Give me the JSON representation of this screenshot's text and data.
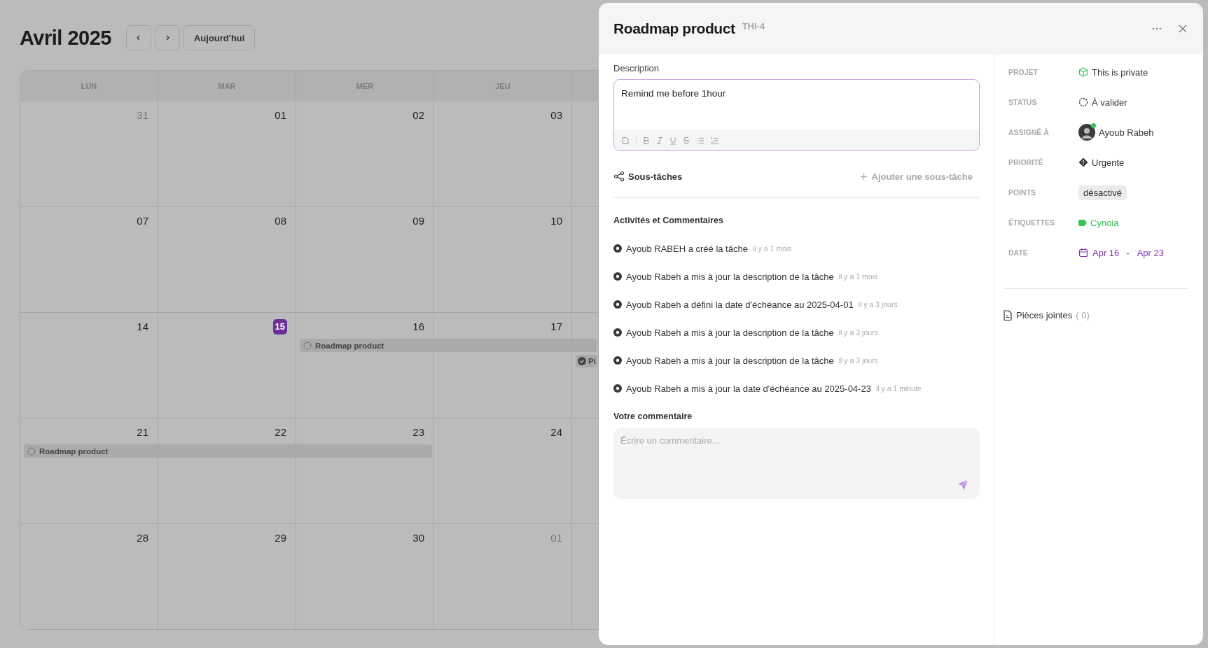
{
  "calendar": {
    "title": "Avril 2025",
    "today_button": "Aujourd'hui",
    "weekdays": [
      "LUN",
      "MAR",
      "MER",
      "JEU"
    ],
    "weeks": [
      {
        "days": [
          {
            "label": "31",
            "muted": true,
            "today": false
          },
          {
            "label": "01",
            "muted": false,
            "today": false
          },
          {
            "label": "02",
            "muted": false,
            "today": false
          },
          {
            "label": "03",
            "muted": false,
            "today": false
          }
        ]
      },
      {
        "days": [
          {
            "label": "07",
            "muted": false,
            "today": false
          },
          {
            "label": "08",
            "muted": false,
            "today": false
          },
          {
            "label": "09",
            "muted": false,
            "today": false
          },
          {
            "label": "10",
            "muted": false,
            "today": false
          }
        ]
      },
      {
        "days": [
          {
            "label": "14",
            "muted": false,
            "today": false
          },
          {
            "label": "15",
            "muted": false,
            "today": true
          },
          {
            "label": "16",
            "muted": false,
            "today": false,
            "bar": {
              "kind": "pending",
              "label": "Roadmap product"
            }
          },
          {
            "label": "17",
            "muted": false,
            "today": false,
            "bar_continues": true
          }
        ],
        "next_day": {
          "bar_continues": true,
          "chip": {
            "kind": "done",
            "label": "Pi"
          }
        }
      },
      {
        "days": [
          {
            "label": "21",
            "muted": false,
            "today": false,
            "bar": {
              "kind": "pending",
              "label": "Roadmap product"
            }
          },
          {
            "label": "22",
            "muted": false,
            "today": false,
            "bar_continues": true
          },
          {
            "label": "23",
            "muted": false,
            "today": false,
            "bar_continues": true
          },
          {
            "label": "24",
            "muted": false,
            "today": false
          }
        ]
      },
      {
        "days": [
          {
            "label": "28",
            "muted": false,
            "today": false
          },
          {
            "label": "29",
            "muted": false,
            "today": false
          },
          {
            "label": "30",
            "muted": false,
            "today": false
          },
          {
            "label": "01",
            "muted": true,
            "today": false
          }
        ]
      }
    ]
  },
  "task": {
    "title": "Roadmap product",
    "key": "THI-4",
    "description_label": "Description",
    "description": "Remind me before 1hour",
    "subtasks_label": "Sous-tâches",
    "add_subtask": "Ajouter une sous-tâche",
    "activity_title": "Activités et Commentaires",
    "activities": [
      {
        "text": "Ayoub RABEH a créé la tâche",
        "time": "il y a 1 mois"
      },
      {
        "text": "Ayoub Rabeh a mis à jour la description de la tâche",
        "time": "il y a 1 mois"
      },
      {
        "text": "Ayoub Rabeh a défini la date d'échéance au 2025-04-01",
        "time": "il y a 3 jours"
      },
      {
        "text": "Ayoub Rabeh a mis à jour la description de la tâche",
        "time": "il y a 3 jours"
      },
      {
        "text": "Ayoub Rabeh a mis à jour la description de la tâche",
        "time": "il y a 3 jours"
      },
      {
        "text": "Ayoub Rabeh a mis à jour la date d'échéance au 2025-04-23",
        "time": "il y a 1 minute"
      }
    ],
    "comment_label": "Votre commentaire",
    "comment_placeholder": "Écrire un commentaire...",
    "properties": [
      {
        "kind": "project",
        "label": "PROJET",
        "value": "This is private"
      },
      {
        "kind": "status",
        "label": "STATUS",
        "value": "À valider"
      },
      {
        "kind": "user",
        "label": "ASSIGNÉ À",
        "value": "Ayoub Rabeh",
        "online": true
      },
      {
        "kind": "priority",
        "label": "PRIORITÉ",
        "value": "Urgente"
      },
      {
        "kind": "chip",
        "label": "POINTS",
        "value": "désactivé"
      },
      {
        "kind": "tag",
        "label": "ÉTIQUETTES",
        "value": "Cynoia",
        "color": "#3cc35a"
      },
      {
        "kind": "date",
        "label": "DATE",
        "from": "Apr 16",
        "separator": "-",
        "to": "Apr 23"
      }
    ],
    "attachments": {
      "label": "Pièces jointes",
      "count": "( 0)"
    }
  }
}
